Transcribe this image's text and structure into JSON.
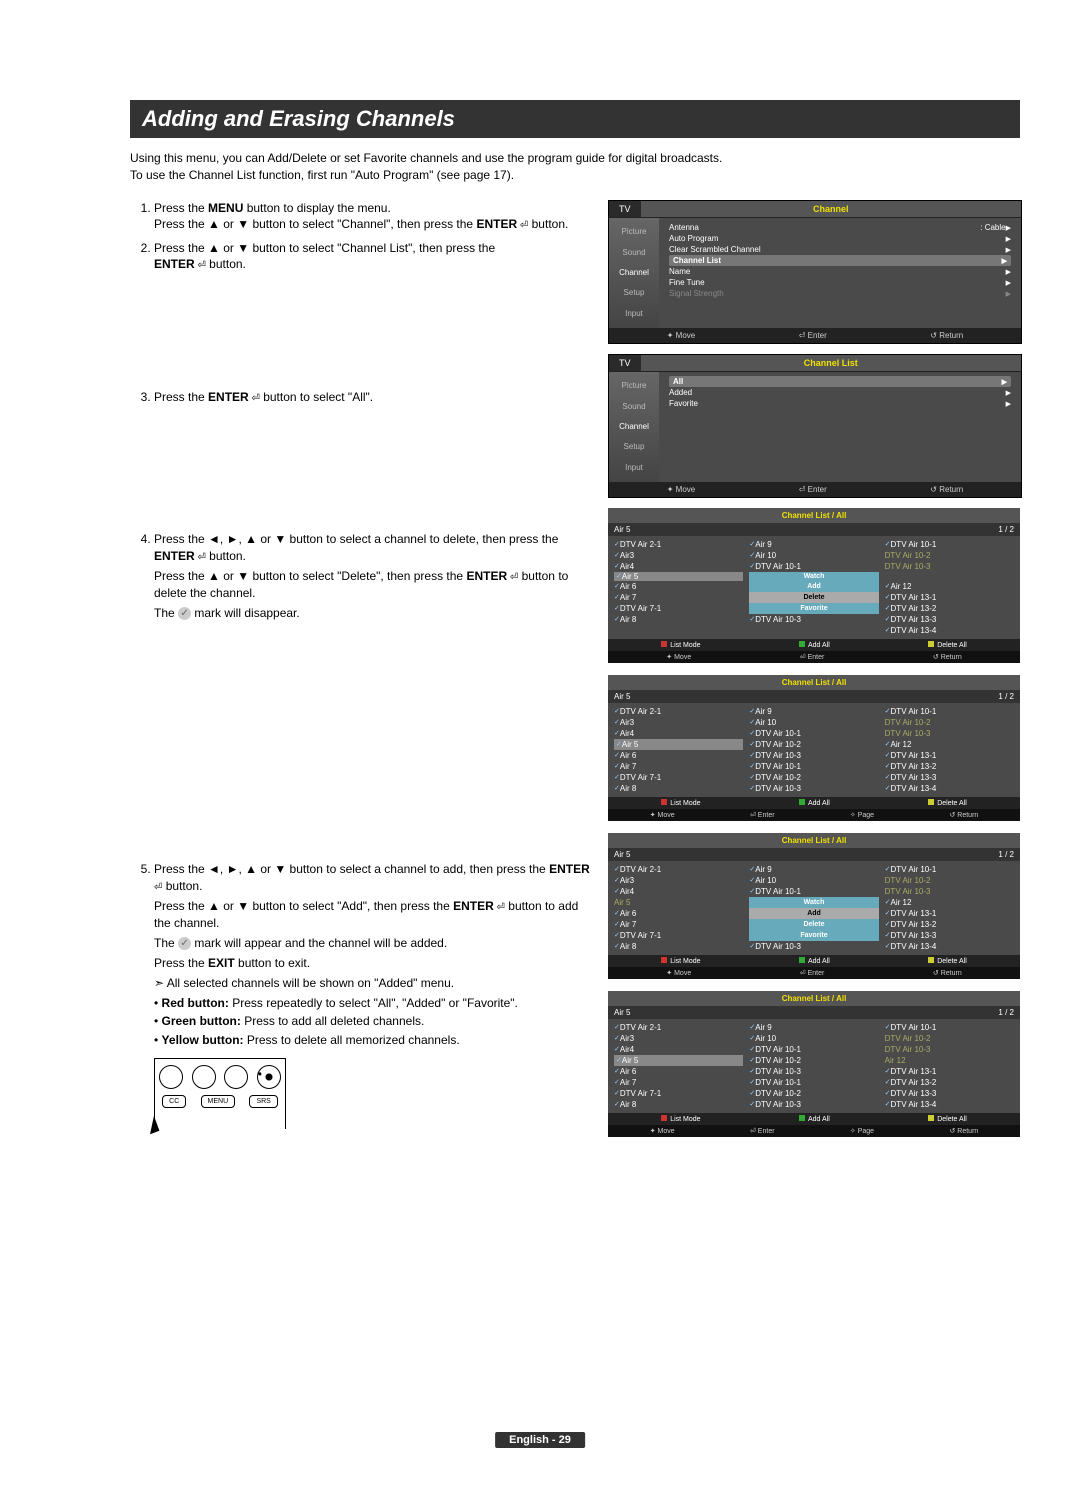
{
  "title": "Adding and Erasing Channels",
  "intro1": "Using this menu, you can Add/Delete or set Favorite channels and use the program guide for digital broadcasts.",
  "intro2": "To use the Channel List function, first run \"Auto Program\" (see page 17).",
  "steps": {
    "s1a": "Press the ",
    "s1a_bold": "MENU",
    "s1a2": " button to display the menu.",
    "s1b": "Press the ▲ or ▼ button to select \"Channel\", then press the ",
    "s1b_bold": "ENTER",
    "s1b2": " button.",
    "s2a": "Press the ▲ or ▼ button to select \"Channel List\", then press the ",
    "s2a_bold": "ENTER",
    "s2a2": " button.",
    "s3a": "Press the ",
    "s3a_bold": "ENTER",
    "s3a2": " button to select \"All\".",
    "s4a": "Press the ◄, ►, ▲ or ▼ button to select a channel to delete, then press the ",
    "s4a_bold": "ENTER",
    "s4a2": " button.",
    "s4b": "Press the ▲ or ▼ button to select \"Delete\", then press the ",
    "s4b_bold": "ENTER",
    "s4b2": " button to delete the channel.",
    "s4c": " mark will disappear.",
    "s5a": "Press the ◄, ►, ▲ or ▼ button to select a channel to add, then press the ",
    "s5a_bold": "ENTER",
    "s5a2": " button.",
    "s5b": "Press the ▲ or ▼ button to select \"Add\", then press the ",
    "s5b_bold": "ENTER",
    "s5b2": " button to add the channel.",
    "s5c_pre": "The ",
    "s5c": " mark will appear and the channel will be added.",
    "s5d": "Press the ",
    "s5d_bold": "EXIT",
    "s5d2": " button to exit.",
    "s5e": "All selected channels will be shown on \"Added\" menu.",
    "s5f_bold": "Red button:",
    "s5f": " Press repeatedly to select \"All\", \"Added\" or \"Favorite\".",
    "s5g_bold": "Green button:",
    "s5g": " Press to add all deleted channels.",
    "s5h_bold": "Yellow button:",
    "s5h": " Press to delete all memorized channels."
  },
  "tv1": {
    "label": "TV",
    "title": "Channel",
    "side": [
      "Picture",
      "Sound",
      "Channel",
      "Setup",
      "Input"
    ],
    "rows": [
      {
        "l": "Antenna",
        "r": ": Cable"
      },
      {
        "l": "Auto Program",
        "r": ""
      },
      {
        "l": "Clear Scrambled Channel",
        "r": ""
      },
      {
        "l": "Channel List",
        "r": "",
        "hl": true
      },
      {
        "l": "Name",
        "r": ""
      },
      {
        "l": "Fine Tune",
        "r": ""
      },
      {
        "l": "Signal Strength",
        "r": "",
        "dim": true
      }
    ],
    "foot": [
      "✦ Move",
      "⏎ Enter",
      "↺ Return"
    ]
  },
  "tv2": {
    "label": "TV",
    "title": "Channel List",
    "side": [
      "Picture",
      "Sound",
      "Channel",
      "Setup",
      "Input"
    ],
    "rows": [
      {
        "l": "All",
        "r": "",
        "hl": true
      },
      {
        "l": "Added",
        "r": ""
      },
      {
        "l": "Favorite",
        "r": ""
      }
    ],
    "foot": [
      "✦ Move",
      "⏎ Enter",
      "↺ Return"
    ]
  },
  "chCommon": {
    "title": "Channel List / All",
    "sub_l": "Air 5",
    "sub_r": "1 / 2",
    "foot1": {
      "red": "List Mode",
      "grn": "Add All",
      "yel": "Delete All"
    },
    "foot2": [
      "✦ Move",
      "⏎ Enter",
      "↺ Return"
    ],
    "foot2b": [
      "✦ Move",
      "⏎ Enter",
      "✧ Page",
      "↺ Return"
    ]
  },
  "ch1": {
    "col1": [
      "DTV Air 2-1",
      "Air3",
      "Air4",
      "Air 5",
      "Air 6",
      "Air 7",
      "DTV Air 7-1",
      "Air 8"
    ],
    "col2": [
      "Air 9",
      "Air 10",
      "DTV Air 10-1",
      "Watch",
      "Add",
      "Delete",
      "Favorite",
      "DTV Air 10-3"
    ],
    "col2_menu": [
      3,
      4,
      5,
      6
    ],
    "col2_menuSel": [
      5
    ],
    "col1_hl": [
      3
    ],
    "col3": [
      "DTV Air 10-1",
      "DTV Air 10-2",
      "DTV Air 10-3",
      "",
      "Air 12",
      "DTV Air 13-1",
      "DTV Air 13-2",
      "DTV Air 13-3",
      "DTV Air 13-4"
    ],
    "col3_dim": [
      1,
      2
    ]
  },
  "ch2": {
    "col1": [
      "DTV Air 2-1",
      "Air3",
      "Air4",
      "Air 5",
      "Air 6",
      "Air 7",
      "DTV Air 7-1",
      "Air 8"
    ],
    "col1_hl": [
      3
    ],
    "col2": [
      "Air 9",
      "Air 10",
      "DTV Air 10-1",
      "DTV Air 10-2",
      "DTV Air 10-3",
      "DTV Air 10-1",
      "DTV Air 10-2",
      "DTV Air 10-3"
    ],
    "col3": [
      "DTV Air 10-1",
      "DTV Air 10-2",
      "DTV Air 10-3",
      "Air 12",
      "DTV Air 13-1",
      "DTV Air 13-2",
      "DTV Air 13-3",
      "DTV Air 13-4"
    ],
    "col3_dim": [
      1,
      2
    ]
  },
  "ch3": {
    "col1": [
      "DTV Air 2-1",
      "Air3",
      "Air4",
      "Air 5",
      "Air 6",
      "Air 7",
      "DTV Air 7-1",
      "Air 8"
    ],
    "col1_dim": [
      3
    ],
    "col2": [
      "Air 9",
      "Air 10",
      "DTV Air 10-1",
      "Watch",
      "Add",
      "Delete",
      "Favorite",
      "DTV Air 10-3"
    ],
    "col2_menu": [
      3,
      4,
      5,
      6
    ],
    "col2_menuSel": [
      4
    ],
    "col3": [
      "DTV Air 10-1",
      "DTV Air 10-2",
      "DTV Air 10-3",
      "Air 12",
      "DTV Air 13-1",
      "DTV Air 13-2",
      "DTV Air 13-3",
      "DTV Air 13-4"
    ],
    "col3_dim": [
      1,
      2
    ]
  },
  "ch4": {
    "col1": [
      "DTV Air 2-1",
      "Air3",
      "Air4",
      "Air 5",
      "Air 6",
      "Air 7",
      "DTV Air 7-1",
      "Air 8"
    ],
    "col1_hl": [
      3
    ],
    "col2": [
      "Air 9",
      "Air 10",
      "DTV Air 10-1",
      "DTV Air 10-2",
      "DTV Air 10-3",
      "DTV Air 10-1",
      "DTV Air 10-2",
      "DTV Air 10-3"
    ],
    "col3": [
      "DTV Air 10-1",
      "DTV Air 10-2",
      "DTV Air 10-3",
      "Air 12",
      "DTV Air 13-1",
      "DTV Air 13-2",
      "DTV Air 13-3",
      "DTV Air 13-4"
    ],
    "col3_dim": [
      1,
      2,
      3
    ]
  },
  "remote": {
    "btns": [
      "CC",
      "MENU",
      "SRS"
    ]
  },
  "footer": "English - 29"
}
